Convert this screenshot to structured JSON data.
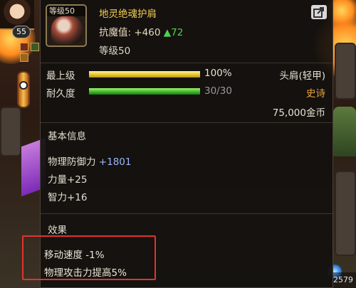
{
  "item": {
    "grade_label": "等级50",
    "name": "地灵绝魂护肩",
    "resist_label": "抗魔值:",
    "resist_value": "+460",
    "resist_up": "▲72",
    "level_text": "等级50"
  },
  "bars": {
    "upgrade_label": "最上级",
    "upgrade_text": "100%",
    "upgrade_fraction": 1.0,
    "durability_label": "耐久度",
    "durability_text": "30/30",
    "durability_fraction": 1.0
  },
  "meta": {
    "slot": "头肩(轻甲)",
    "rarity": "史诗",
    "price": "75,000金币"
  },
  "basic": {
    "heading": "基本信息",
    "stats": [
      {
        "name": "物理防御力",
        "value": "+1801"
      },
      {
        "name": "力量",
        "value": "+25"
      },
      {
        "name": "智力",
        "value": "+16"
      }
    ]
  },
  "effects": {
    "heading": "效果",
    "lines": [
      "移动速度 -1%",
      "物理攻击力提高5%"
    ]
  },
  "hud": {
    "player_level": "55",
    "counter": "2579"
  },
  "colors": {
    "title": "#f3ce53",
    "rarity": "#e8a43b",
    "resist_up": "#4fd14f",
    "stat_number": "#9bb6ff",
    "highlight": "#e0342f"
  },
  "icons": [
    "share-icon",
    "item-shoulder-icon"
  ]
}
